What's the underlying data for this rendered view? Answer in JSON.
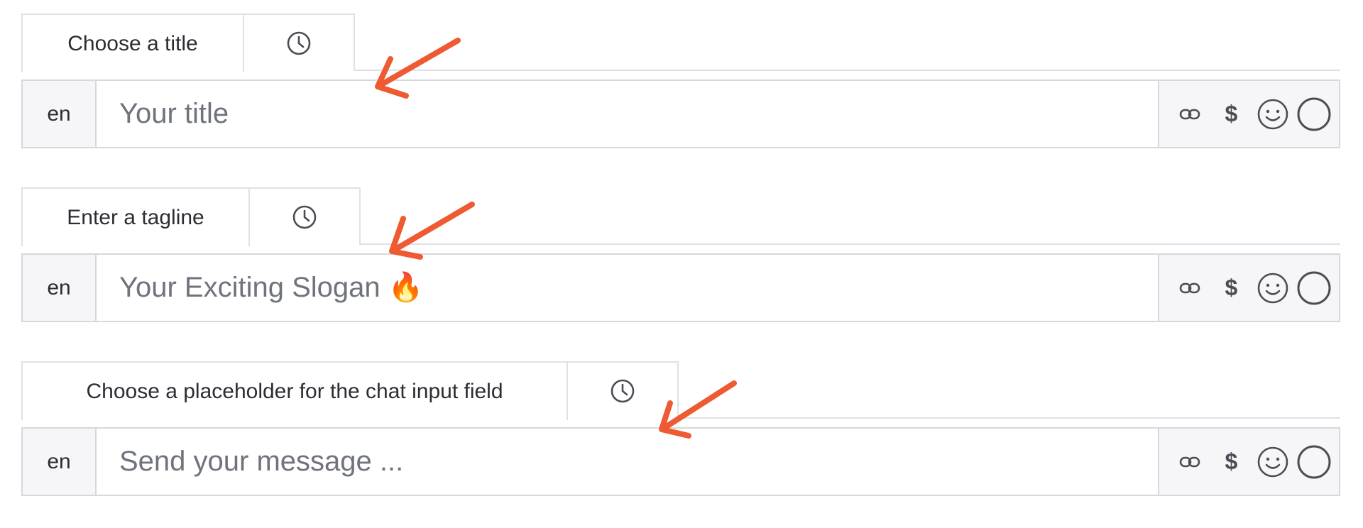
{
  "fields": [
    {
      "tab_label": "Choose a title",
      "language": "en",
      "placeholder": "Your title"
    },
    {
      "tab_label": "Enter a tagline",
      "language": "en",
      "placeholder": "Your Exciting Slogan 🔥"
    },
    {
      "tab_label": "Choose a placeholder for the chat input field",
      "language": "en",
      "placeholder": "Send your message ..."
    }
  ],
  "toolbar": {
    "dollar_symbol": "$"
  },
  "colors": {
    "border": "#d6d8de",
    "panel_bg": "#f6f6f8",
    "placeholder_text": "#6f737b",
    "annotation_arrow": "#ee5a32"
  },
  "icons": [
    "clock-icon",
    "link-icon",
    "dollar-icon",
    "smiley-icon",
    "circle-icon",
    "annotation-arrow-icon"
  ]
}
